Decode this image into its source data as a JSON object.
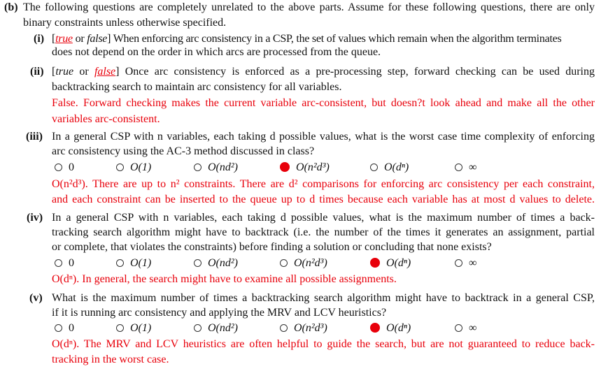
{
  "part_b": {
    "label": "(b)",
    "lines": [
      "The following questions are completely unrelated to the above parts. Assume for these following questions, there are only",
      "binary constraints unless otherwise specified."
    ]
  },
  "q1": {
    "label": "(i)",
    "open": "[",
    "true": "true",
    "or": " or ",
    "false": "false",
    "close": "]",
    "line1_rest": " When enforcing arc consistency in a CSP, the set of values which remain when the algorithm terminates",
    "line2": "does not depend on the order in which arcs are processed from the queue.",
    "selected": "true"
  },
  "q2": {
    "label": "(ii)",
    "open": "[",
    "true": "true",
    "or": " or ",
    "false": "false",
    "close": "]",
    "line1_rest": " Once arc consistency is enforced as a pre-processing step, forward checking can be used during",
    "line2": "backtracking search to maintain arc consistency for all variables.",
    "selected": "false",
    "explanation": [
      "False. Forward checking makes the current variable arc-consistent, but doesn?t look ahead and make all the other",
      "variables arc-consistent."
    ]
  },
  "q3": {
    "label": "(iii)",
    "lines": [
      "In a general CSP with n variables, each taking d possible values, what is the worst case time complexity of enforcing",
      "arc consistency using the AC-3 method discussed in class?"
    ],
    "options": [
      "0",
      "O(1)",
      "O(nd²)",
      "O(n²d³)",
      "O(dⁿ)",
      "∞"
    ],
    "selected_index": 3,
    "explanation": [
      "O(n²d³). There are up to n² constraints. There are d² comparisons for enforcing arc consistency per each constraint,",
      "and each constraint can be inserted to the queue up to d times because each variable has at most d values to delete."
    ]
  },
  "q4": {
    "label": "(iv)",
    "lines": [
      "In a general CSP with n variables, each taking d possible values, what is the maximum number of times a back-",
      "tracking search algorithm might have to backtrack (i.e. the number of the times it generates an assignment, partial",
      "or complete, that violates the constraints) before finding a solution or concluding that none exists?"
    ],
    "options": [
      "0",
      "O(1)",
      "O(nd²)",
      "O(n²d³)",
      "O(dⁿ)",
      "∞"
    ],
    "selected_index": 4,
    "explanation": [
      "O(dⁿ). In general, the search might have to examine all possible assignments."
    ]
  },
  "q5": {
    "label": "(v)",
    "lines": [
      "What is the maximum number of times a backtracking search algorithm might have to backtrack in a general CSP,",
      "if it is running arc consistency and applying the MRV and LCV heuristics?"
    ],
    "options": [
      "0",
      "O(1)",
      "O(nd²)",
      "O(n²d³)",
      "O(dⁿ)",
      "∞"
    ],
    "selected_index": 4,
    "explanation": [
      "O(dⁿ). The MRV and LCV heuristics are often helpful to guide the search, but are not guaranteed to reduce back-",
      "tracking in the worst case."
    ]
  },
  "colors": {
    "answer": "#e8000b",
    "text": "#111111"
  }
}
